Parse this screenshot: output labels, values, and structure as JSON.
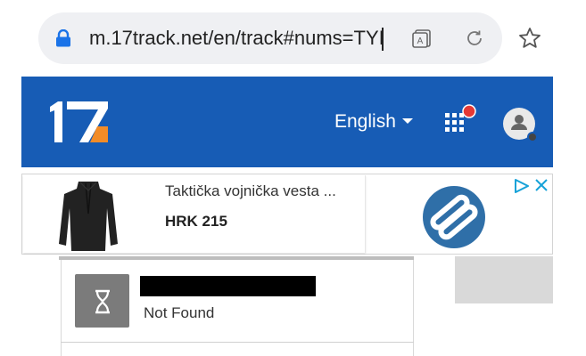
{
  "browser": {
    "url": "m.17track.net/en/track#nums=TYI",
    "icons": [
      "lock-icon",
      "reader-mode-icon",
      "reload-icon",
      "bookmark-star-icon"
    ]
  },
  "header": {
    "logo_text": "17",
    "language": "English",
    "colors": {
      "header_bg": "#175cb5",
      "logo_accent": "#f28c28",
      "notification_dot": "#e53935"
    }
  },
  "ad": {
    "title": "Taktička vojnička vesta ...",
    "price": "HRK 215"
  },
  "tracking": {
    "status": "Not Found"
  }
}
